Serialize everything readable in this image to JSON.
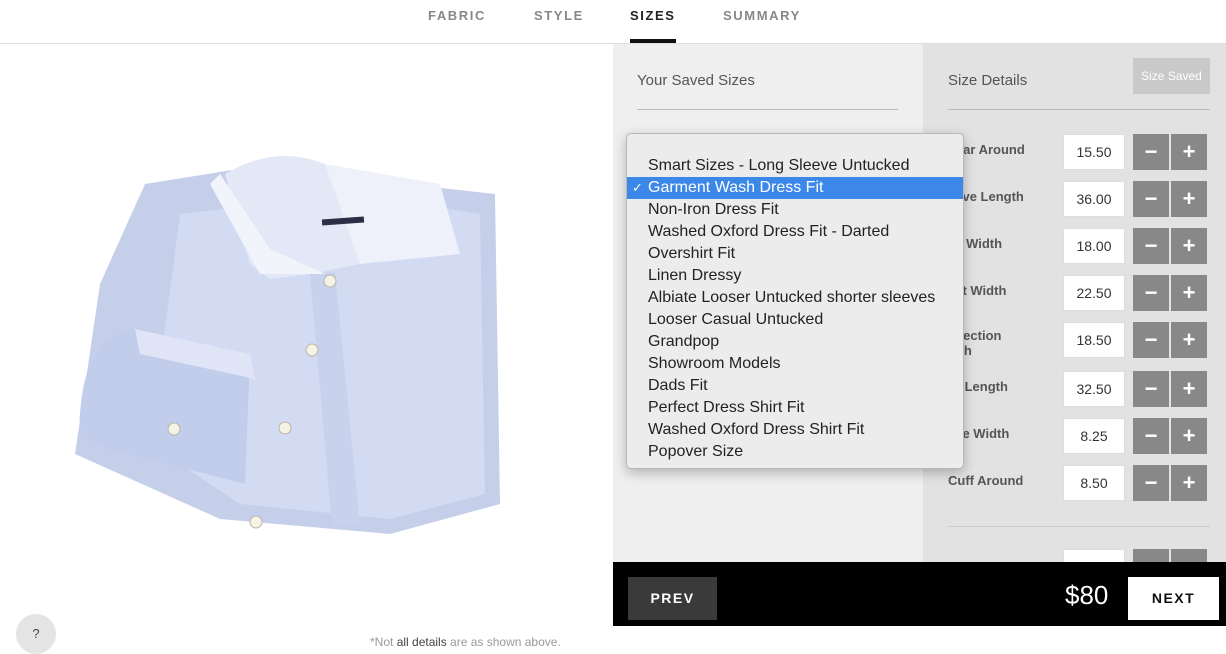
{
  "nav": {
    "tabs": [
      {
        "label": "FABRIC"
      },
      {
        "label": "STYLE"
      },
      {
        "label": "SIZES"
      },
      {
        "label": "SUMMARY"
      }
    ],
    "active_tab": "SIZES"
  },
  "preview": {
    "help_label": "?",
    "note_prefix": "*Not ",
    "note_emph": "all details",
    "note_suffix": " are as shown above."
  },
  "saved_sizes": {
    "title": "Your Saved Sizes",
    "options": [
      "Smart Sizes - Long Sleeve Untucked",
      "Garment Wash Dress Fit",
      "Non-Iron Dress Fit",
      "Washed Oxford Dress Fit - Darted",
      "Overshirt Fit",
      "Linen Dressy",
      "Albiate Looser Untucked shorter sleeves",
      "Looser Casual Untucked",
      "Grandpop",
      "Showroom Models",
      "Dads Fit",
      "Perfect Dress Shirt Fit",
      "Washed Oxford Dress Shirt Fit",
      "Popover Size"
    ],
    "selected": "Garment Wash Dress Fit",
    "check_glyph": "✓"
  },
  "size_details": {
    "title": "Size Details",
    "saved_button": "Size Saved",
    "minus_glyph": "−",
    "plus_glyph": "+",
    "rows": [
      {
        "label": "ollar Around",
        "value": "15.50"
      },
      {
        "label": "eeve Length",
        "value": "36.00"
      },
      {
        "label": "ke Width",
        "value": "18.00"
      },
      {
        "label": "est Width",
        "value": "22.50"
      },
      {
        "label": "dsection idth",
        "value": "18.50"
      },
      {
        "label": "irt Length",
        "value": "32.50"
      },
      {
        "label": "eve Width",
        "value": "8.25"
      },
      {
        "label": "Cuff Around",
        "value": "8.50"
      }
    ]
  },
  "footer": {
    "prev_label": "PREV",
    "price": "$80",
    "next_label": "NEXT"
  }
}
